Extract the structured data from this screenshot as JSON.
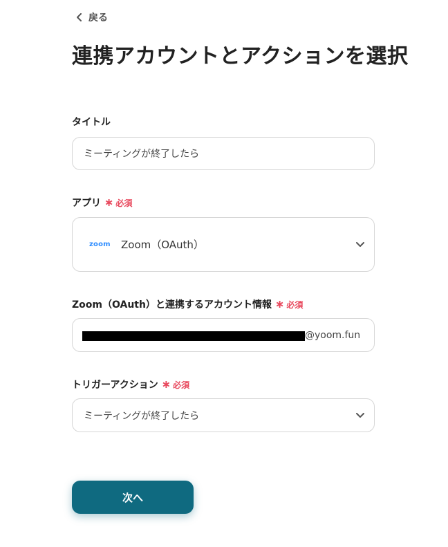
{
  "nav": {
    "back_label": "戻る"
  },
  "page": {
    "title": "連携アカウントとアクションを選択"
  },
  "required_label": "必須",
  "form": {
    "title_field": {
      "label": "タイトル",
      "value": "ミーティングが終了したら"
    },
    "app_field": {
      "label": "アプリ",
      "logo_text": "zoom",
      "value": "Zoom（OAuth）"
    },
    "account_field": {
      "label": "Zoom（OAuth）と連携するアカウント情報",
      "value_suffix": "@yoom.fun"
    },
    "trigger_field": {
      "label": "トリガーアクション",
      "value": "ミーティングが終了したら"
    }
  },
  "actions": {
    "next_label": "次へ",
    "next_color": "#0f6a80"
  },
  "colors": {
    "required": "#e8475c",
    "zoom_brand": "#2d8cff"
  }
}
